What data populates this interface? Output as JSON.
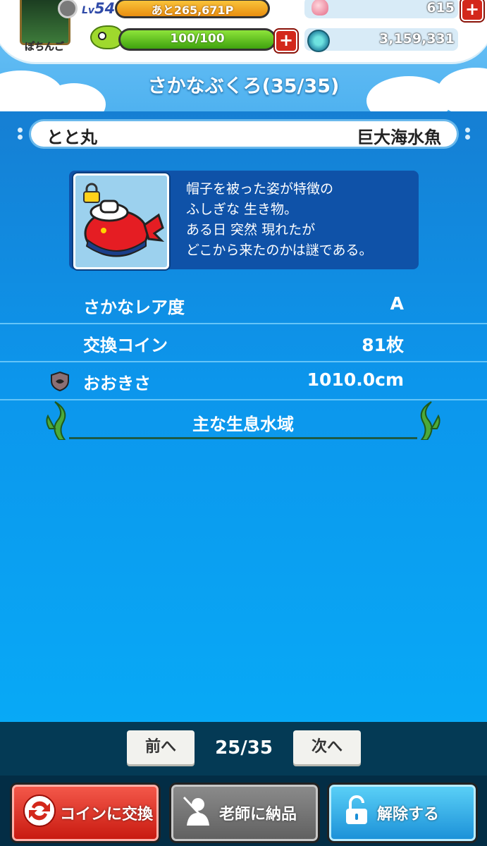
{
  "header": {
    "player_name": "ぽちんご",
    "level_prefix": "Lv",
    "level": "54",
    "exp_remaining": "あと265,671P",
    "stamina": "100/100",
    "gems": "615",
    "coins": "3,159,331",
    "screen_title": "さかなぶくろ(35/35)"
  },
  "fish": {
    "name": "とと丸",
    "category": "巨大海水魚",
    "description": "帽子を被った姿が特徴の\nふしぎな 生き物。\nある日 突然 現れたが\nどこから来たのかは謎である。",
    "locked": true
  },
  "stats": [
    {
      "label": "さかなレア度",
      "value": "A"
    },
    {
      "label": "交換コイン",
      "value": "81枚"
    },
    {
      "label": "おおきさ",
      "value": "1010.0cm"
    }
  ],
  "habitat": {
    "title": "主な生息水域"
  },
  "pager": {
    "prev_label": "前へ",
    "count": "25/35",
    "next_label": "次へ"
  },
  "actions": {
    "exchange_label": "コインに交換",
    "teacher_label": "老師に納品",
    "unlock_label": "解除する"
  },
  "colors": {
    "accent_red": "#d3281b",
    "panel_blue": "#0c96ec",
    "unlock_blue": "#1a8fd7"
  }
}
